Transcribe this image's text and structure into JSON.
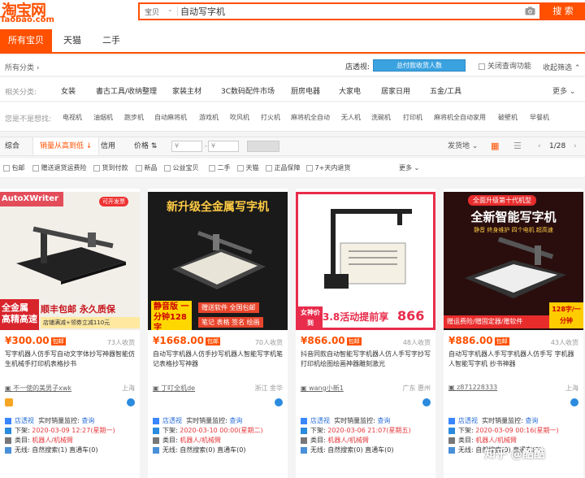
{
  "header": {
    "logo_text": "淘宝网",
    "logo_domain": "Taobao.com",
    "search_category": "宝贝",
    "search_value": "自动写字机",
    "search_button": "搜 索"
  },
  "tabs": [
    {
      "label": "所有宝贝",
      "active": true
    },
    {
      "label": "天猫",
      "active": false
    },
    {
      "label": "二手",
      "active": false
    }
  ],
  "filters": {
    "all_categories": "所有分类",
    "shop_label": "店透视:",
    "shop_button": "总付款收货人数",
    "close_query": "关闭查询功能",
    "collapse": "收起筛选",
    "related_label": "相关分类:",
    "related_items": [
      "女装",
      "書古工具/收纳整理",
      "家装主材",
      "3C数码配件市场",
      "厨房电器",
      "大家电",
      "居家日用",
      "五金/工具"
    ],
    "more": "更多",
    "want_label": "您是不是想找:",
    "want_items": [
      "电视机",
      "油烟机",
      "跑步机",
      "自动麻将机",
      "游戏机",
      "吹风机",
      "打火机",
      "麻将机全自动",
      "无人机",
      "洗碗机",
      "打印机",
      "麻将机全自动家用",
      "破壁机",
      "早餐机"
    ]
  },
  "sort": {
    "items": [
      "综合",
      "销量从高到低",
      "信用",
      "价格"
    ],
    "active_index": 1,
    "price_from": "¥",
    "price_to": "¥",
    "ship_from": "发货地",
    "page": "1/28"
  },
  "filter_checks": [
    "包邮",
    "赠送退货运费险",
    "货到付款",
    "新品",
    "公益宝贝",
    "二手",
    "天猫",
    "正品保障",
    "7+天内退货"
  ],
  "filter_more": "更多",
  "products": [
    {
      "image_caption": "AutoXWriter",
      "image_tag": "可开发票",
      "image_headline": "全金属 高精高速",
      "image_sub": "顺丰包邮 永久质保",
      "image_promo": "店铺满减+领券立减110元",
      "price": "¥300.00",
      "pay_badge": "包邮",
      "buyers": "73人收货",
      "title": "写字机器人仿手写自动文字体抄写神器智能仿生机械手打印机表格抄书",
      "shop": "不一使的美男子xwk",
      "location": "上海"
    },
    {
      "image_caption": "新升级全金属写字机",
      "image_tag": "",
      "image_headline": "静音版 一分钟128字",
      "image_sub": "赠送软件 全国包邮",
      "image_promo": "笔记 表格 签名 绘画",
      "price": "¥1668.00",
      "pay_badge": "包邮",
      "buyers": "70人收货",
      "title": "自动写字机器人仿手抄写机器人智能写字机笔记表格抄写神器",
      "shop": "丁叮全机de",
      "location": "浙江 金华"
    },
    {
      "image_caption": "",
      "image_tag": "",
      "image_headline": "女神价到",
      "image_sub": "3.8活动提前享",
      "image_promo": "866",
      "price": "¥866.00",
      "pay_badge": "包邮",
      "buyers": "48人收货",
      "title": "抖音同款自动智能写字机器人仿人手写字抄写打印机绘图绘画神器雕刻激光",
      "shop": "wang小新1",
      "location": "广东 惠州"
    },
    {
      "image_caption": "全面升级第十代机型",
      "image_tag": "",
      "image_headline": "全新智能写字机",
      "image_sub": "静音 终身维护 四个电机 超高速",
      "image_promo": "赠运费险/赠固定器/赠软件",
      "price": "¥886.00",
      "pay_badge": "包邮",
      "buyers": "43人收货",
      "title": "自动写字机器人手写字机器人仿手写 字机器人智能写字机 抄书神器",
      "shop": "z871228333",
      "location": "上海"
    }
  ],
  "product_info": [
    {
      "shop_view": "店透视",
      "realtime": "实时销量监控:",
      "query": "查询",
      "shelf_label": "下架:",
      "shelf_time": "2020-03-09 12:27(星期一)",
      "cat_label": "类目:",
      "cat_value": "机器人/机械臂",
      "wireless_label": "无线:",
      "wireless_value": "自然搜索(1) 直通车(0)"
    },
    {
      "shop_view": "店透视",
      "realtime": "实时销量监控:",
      "query": "查询",
      "shelf_label": "下架:",
      "shelf_time": "2020-03-10 00:00(星期二)",
      "cat_label": "类目:",
      "cat_value": "机器人/机械臂",
      "wireless_label": "无线:",
      "wireless_value": "自然搜索(0) 直通车(0)"
    },
    {
      "shop_view": "店透视",
      "realtime": "实时销量监控:",
      "query": "查询",
      "shelf_label": "下架:",
      "shelf_time": "2020-03-06 21:07(星期五)",
      "cat_label": "类目:",
      "cat_value": "机器人/机械臂",
      "wireless_label": "无线:",
      "wireless_value": "自然搜索(0) 直通车(0)"
    },
    {
      "shop_view": "店透视",
      "realtime": "实时销量监控:",
      "query": "查询",
      "shelf_label": "下架:",
      "shelf_time": "2020-03-09 00:16(星期一)",
      "cat_label": "类目:",
      "cat_value": "机器人/机械臂",
      "wireless_label": "无线:",
      "wireless_value": "自然搜索(0) 直通车(0)"
    }
  ],
  "watermark": "知乎 @酷酷",
  "colors": {
    "brand": "#ff5000",
    "blue": "#3ba2e0"
  }
}
